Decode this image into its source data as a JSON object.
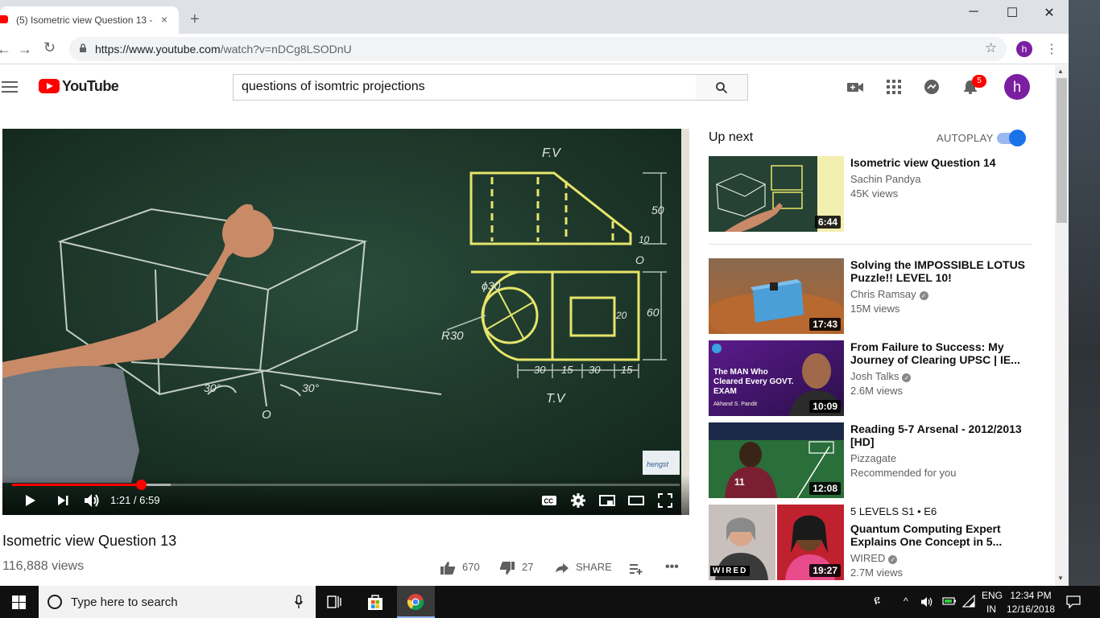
{
  "browser": {
    "tab_title": "(5) Isometric view Question 13 - Yo",
    "tab_close": "×",
    "new_tab": "+",
    "url_host": "https://www.youtube.com",
    "url_path": "/watch?v=nDCg8LSODnU",
    "profile_initial": "h",
    "window_controls": {
      "minimize": "─",
      "maximize": "☐",
      "close": "✕"
    }
  },
  "youtube": {
    "logo_text": "YouTube",
    "search_value": "questions of isomtric projections",
    "notification_count": "5",
    "avatar_initial": "h"
  },
  "video": {
    "time": "1:21 / 6:59",
    "progress_fraction": 0.193,
    "buffered_fraction": 0.238,
    "title": "Isometric view Question 13",
    "views": "116,888 views",
    "likes": "670",
    "dislikes": "27",
    "share_label": "SHARE",
    "board_labels": {
      "fv": "F.V",
      "tv": "T.V",
      "phi30": "ϕ30",
      "r30": "R30",
      "dim50": "50",
      "dim60": "60",
      "dim10": "10",
      "dim20": "20",
      "dims_bottom": [
        "30",
        "15",
        "30",
        "15"
      ],
      "angle_left": "30°",
      "angle_right": "30°",
      "origin": "O",
      "origin2": "O"
    },
    "watermark": "hengst"
  },
  "sidebar": {
    "up_next_label": "Up next",
    "autoplay_label": "AUTOPLAY",
    "autoplay_on": true,
    "recommendations": [
      {
        "title": "Isometric view Question 14",
        "channel": "Sachin Pandya",
        "meta": "45K views",
        "duration": "6:44",
        "verified": false
      },
      {
        "title": "Solving the IMPOSSIBLE LOTUS Puzzle!! LEVEL 10!",
        "channel": "Chris Ramsay",
        "meta": "15M views",
        "duration": "17:43",
        "verified": true
      },
      {
        "title": "From Failure to Success: My Journey of Clearing UPSC | IE...",
        "channel": "Josh Talks",
        "meta": "2.6M views",
        "duration": "10:09",
        "verified": true,
        "thumb_text": "The MAN Who Cleared Every GOVT. EXAM",
        "thumb_caption": "Akhand S. Pandit"
      },
      {
        "title": "Reading 5-7 Arsenal - 2012/2013 [HD]",
        "channel": "Pizzagate",
        "meta": "Recommended for you",
        "duration": "12:08",
        "verified": false
      },
      {
        "top_line": "5 LEVELS  S1 • E6",
        "title": "Quantum Computing Expert Explains One Concept in 5...",
        "channel": "WIRED",
        "meta": "2.7M views",
        "duration": "19:27",
        "verified": true,
        "thumb_text": "WIRED"
      }
    ]
  },
  "taskbar": {
    "search_placeholder": "Type here to search",
    "lang_top": "ENG",
    "lang_bottom": "IN",
    "time": "12:34 PM",
    "date": "12/16/2018"
  },
  "colors": {
    "brand_red": "#ff0000",
    "accent_blue": "#1a73e8",
    "board_green": "#1f3a2e",
    "chalk_yellow": "#e6e56a"
  }
}
